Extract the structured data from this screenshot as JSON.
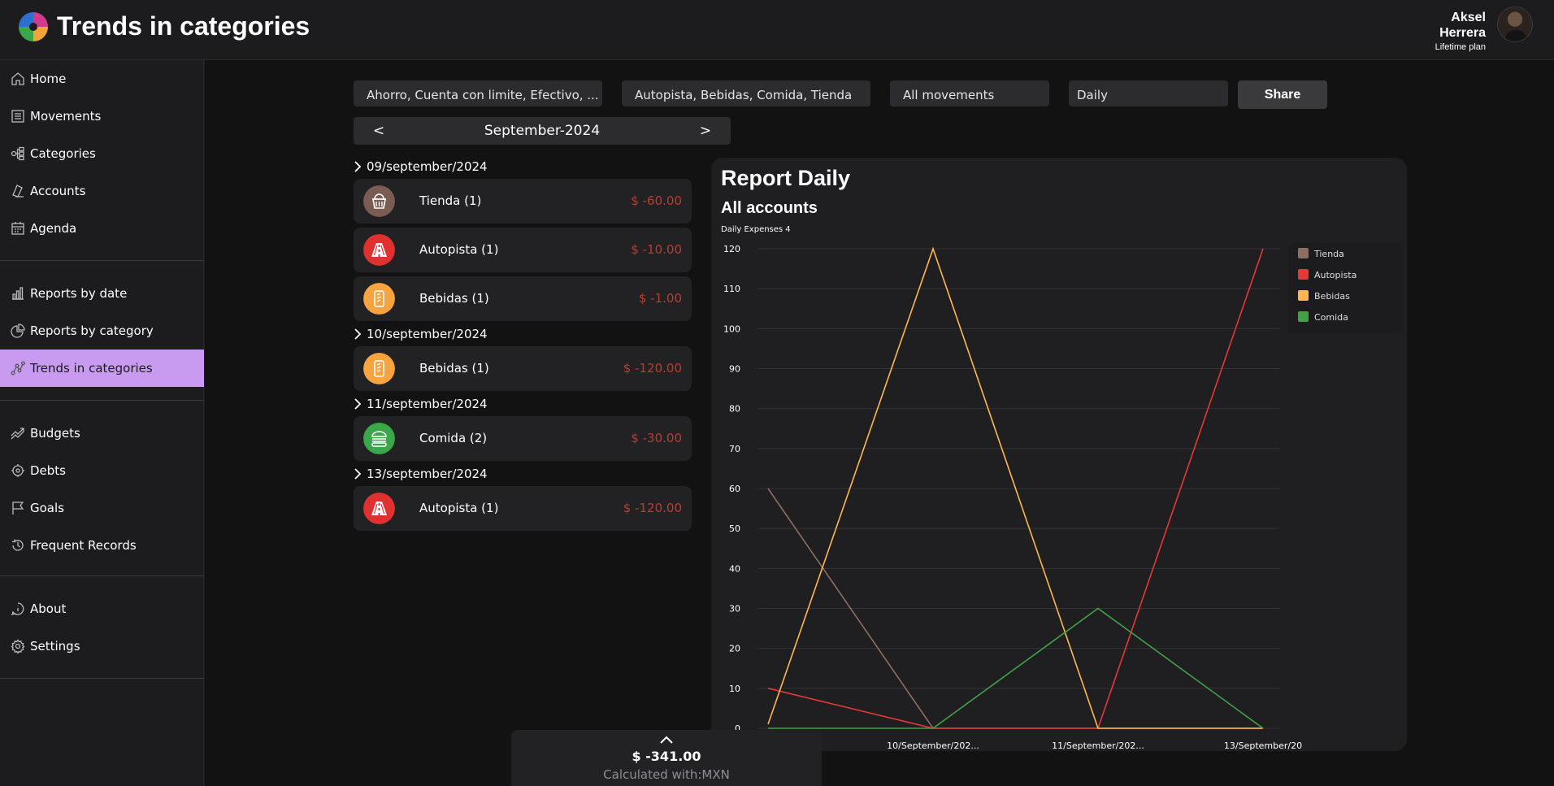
{
  "header": {
    "title": "Trends in categories",
    "user_first": "Aksel",
    "user_last": "Herrera",
    "plan": "Lifetime plan"
  },
  "sidebar": {
    "items": [
      {
        "label": "Home",
        "icon": "home-icon"
      },
      {
        "label": "Movements",
        "icon": "list-icon"
      },
      {
        "label": "Categories",
        "icon": "tree-icon"
      },
      {
        "label": "Accounts",
        "icon": "wallet-icon"
      },
      {
        "label": "Agenda",
        "icon": "calendar-icon"
      },
      {
        "label": "Reports by date",
        "icon": "bar-chart-icon"
      },
      {
        "label": "Reports by category",
        "icon": "pie-chart-icon"
      },
      {
        "label": "Trends in categories",
        "icon": "trend-icon",
        "active": true
      },
      {
        "label": "Budgets",
        "icon": "budget-icon"
      },
      {
        "label": "Debts",
        "icon": "debt-icon"
      },
      {
        "label": "Goals",
        "icon": "flag-icon"
      },
      {
        "label": "Frequent Records",
        "icon": "history-icon"
      },
      {
        "label": "About",
        "icon": "info-icon"
      },
      {
        "label": "Settings",
        "icon": "gear-icon"
      }
    ]
  },
  "filters": {
    "accounts": "Ahorro, Cuenta con limite, Efectivo, ...",
    "categories": "Autopista, Bebidas, Comida, Tienda",
    "movement_type": "All movements",
    "period": "Daily",
    "share_label": "Share"
  },
  "month_nav": {
    "prev": "<",
    "label": "September-2024",
    "next": ">"
  },
  "days": [
    {
      "date": "09/september/2024",
      "movements": [
        {
          "name": "Tienda (1)",
          "amount": "$ -60.00",
          "color": "#7a5c52",
          "icon": "basket-icon"
        },
        {
          "name": "Autopista (1)",
          "amount": "$ -10.00",
          "color": "#e03131",
          "icon": "highway-icon"
        },
        {
          "name": "Bebidas (1)",
          "amount": "$ -1.00",
          "color": "#f7a440",
          "icon": "drink-icon"
        }
      ]
    },
    {
      "date": "10/september/2024",
      "movements": [
        {
          "name": "Bebidas (1)",
          "amount": "$ -120.00",
          "color": "#f7a440",
          "icon": "drink-icon"
        }
      ]
    },
    {
      "date": "11/september/2024",
      "movements": [
        {
          "name": "Comida (2)",
          "amount": "$ -30.00",
          "color": "#3aa84a",
          "icon": "burger-icon"
        }
      ]
    },
    {
      "date": "13/september/2024",
      "movements": [
        {
          "name": "Autopista (1)",
          "amount": "$ -120.00",
          "color": "#e03131",
          "icon": "highway-icon"
        }
      ]
    }
  ],
  "report": {
    "title": "Report Daily",
    "subtitle": "All accounts",
    "chart_caption": "Daily Expenses 4"
  },
  "chart_data": {
    "type": "line",
    "x": [
      "09/September/2024",
      "10/September/2024",
      "11/September/2024",
      "13/September/2024"
    ],
    "x_tick_labels": [
      "10/September/202...",
      "11/September/202...",
      "13/September/20"
    ],
    "ylim": [
      0,
      120
    ],
    "yticks": [
      0,
      10,
      20,
      30,
      40,
      50,
      60,
      70,
      80,
      90,
      100,
      110,
      120
    ],
    "grid": true,
    "legend_position": "top-right",
    "series": [
      {
        "name": "Tienda",
        "color": "#8d6e63",
        "values": [
          60,
          0,
          0,
          0
        ]
      },
      {
        "name": "Autopista",
        "color": "#e53935",
        "values": [
          10,
          0,
          0,
          120
        ]
      },
      {
        "name": "Bebidas",
        "color": "#ffb74d",
        "values": [
          1,
          120,
          0,
          0
        ]
      },
      {
        "name": "Comida",
        "color": "#43a047",
        "values": [
          0,
          0,
          30,
          0
        ]
      }
    ]
  },
  "footer": {
    "total": "$ -341.00",
    "currency": "Calculated with:MXN"
  }
}
